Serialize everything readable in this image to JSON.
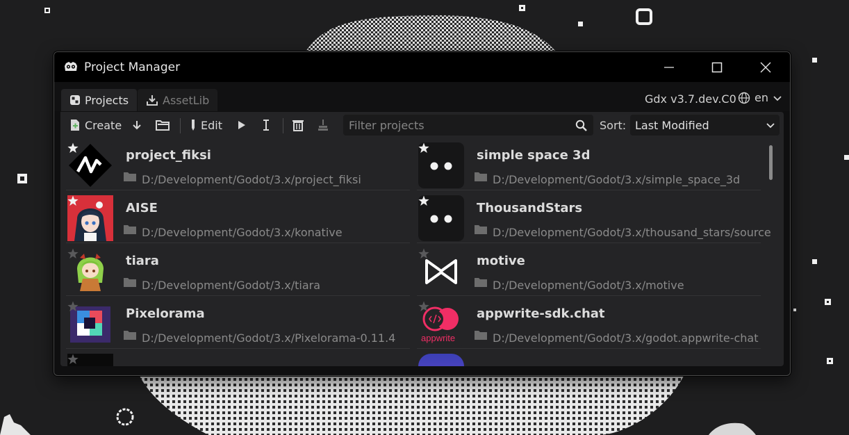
{
  "window": {
    "title": "Project Manager"
  },
  "tabs": [
    {
      "label": "Projects",
      "active": true
    },
    {
      "label": "AssetLib",
      "active": false
    }
  ],
  "version": "Gdx v3.7.dev.C0",
  "language": "en",
  "toolbar": {
    "create_label": "Create",
    "edit_label": "Edit",
    "filter_placeholder": "Filter projects",
    "sort_label": "Sort:",
    "sort_value": "Last Modified"
  },
  "projects": [
    {
      "name": "project_fiksi",
      "path": "D:/Development/Godot/3.x/project_fiksi",
      "favorite": true,
      "icon": "fiksi-logo"
    },
    {
      "name": "simple space 3d",
      "path": "D:/Development/Godot/3.x/simple_space_3d",
      "favorite": true,
      "icon": "default-dots"
    },
    {
      "name": "AISE",
      "path": "D:/Development/Godot/3.x/konative",
      "favorite": true,
      "icon": "anime-girl"
    },
    {
      "name": "ThousandStars",
      "path": "D:/Development/Godot/3.x/thousand_stars/source",
      "favorite": true,
      "icon": "default-dots"
    },
    {
      "name": "tiara",
      "path": "D:/Development/Godot/3.x/tiara",
      "favorite": false,
      "icon": "chibi-girl"
    },
    {
      "name": "motive",
      "path": "D:/Development/Godot/3.x/motive",
      "favorite": false,
      "icon": "bowtie-logo"
    },
    {
      "name": "Pixelorama",
      "path": "D:/Development/Godot/3.x/Pixelorama-0.11.4",
      "favorite": false,
      "icon": "pixelorama-logo"
    },
    {
      "name": "appwrite-sdk.chat",
      "path": "D:/Development/Godot/3.x/godot.appwrite-chat",
      "favorite": false,
      "icon": "appwrite-logo",
      "icon_text": "appwrite"
    }
  ],
  "colors": {
    "background": "#1e1e1f",
    "panel": "#242426",
    "titlebar": "#000000",
    "appwrite": "#f02e65"
  }
}
